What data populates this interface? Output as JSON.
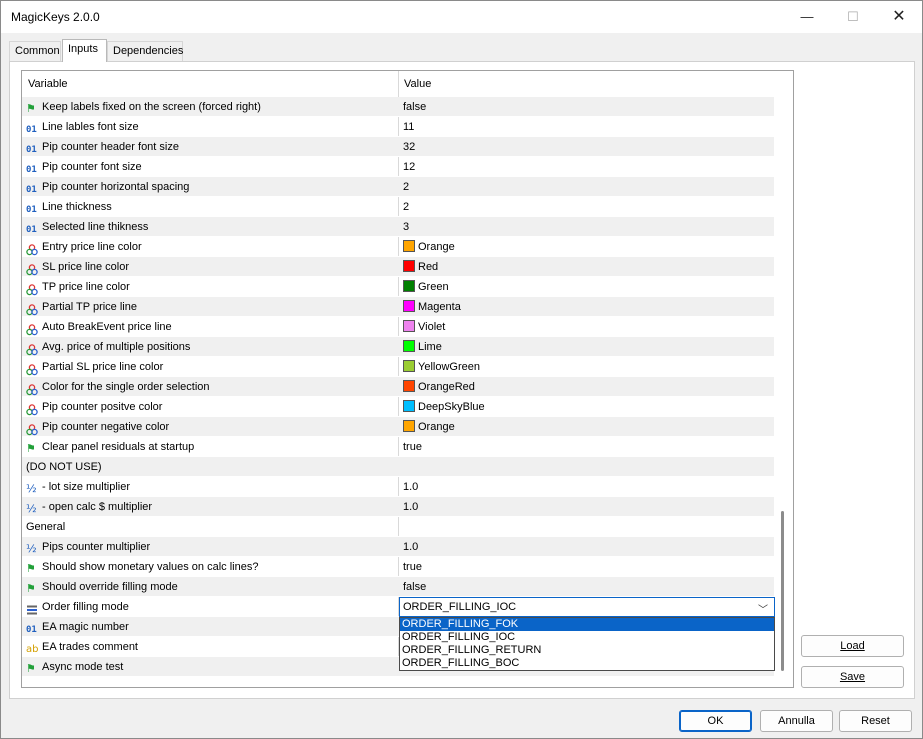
{
  "window": {
    "title": "MagicKeys 2.0.0",
    "minimize_glyph": "—",
    "maximize_glyph": "☐",
    "close_glyph": "✕"
  },
  "tabs": [
    {
      "label": "Common",
      "active": false
    },
    {
      "label": "Inputs",
      "active": true
    },
    {
      "label": "Dependencies",
      "active": false
    }
  ],
  "grid": {
    "col_variable": "Variable",
    "col_value": "Value",
    "rows": [
      {
        "icon": "bool-flag-icon",
        "name": "Keep labels fixed on the screen (forced right)",
        "value": "false"
      },
      {
        "icon": "int-icon",
        "name": "Line lables font size",
        "value": "11"
      },
      {
        "icon": "int-icon",
        "name": "Pip counter header font size",
        "value": "32"
      },
      {
        "icon": "int-icon",
        "name": "Pip counter font size",
        "value": "12"
      },
      {
        "icon": "int-icon",
        "name": "Pip counter horizontal spacing",
        "value": "2"
      },
      {
        "icon": "int-icon",
        "name": "Line thickness",
        "value": "2"
      },
      {
        "icon": "int-icon",
        "name": "Selected line thikness",
        "value": "3"
      },
      {
        "icon": "color-icon",
        "name": "Entry price line color",
        "value": "Orange",
        "swatch": "#ffa500"
      },
      {
        "icon": "color-icon",
        "name": "SL price line color",
        "value": "Red",
        "swatch": "#ff0000"
      },
      {
        "icon": "color-icon",
        "name": "TP price line color",
        "value": "Green",
        "swatch": "#008000"
      },
      {
        "icon": "color-icon",
        "name": "Partial TP price line",
        "value": "Magenta",
        "swatch": "#ff00ff"
      },
      {
        "icon": "color-icon",
        "name": "Auto BreakEvent price line",
        "value": "Violet",
        "swatch": "#ee82ee"
      },
      {
        "icon": "color-icon",
        "name": "Avg. price of multiple positions",
        "value": "Lime",
        "swatch": "#00ff00"
      },
      {
        "icon": "color-icon",
        "name": "Partial SL price line color",
        "value": "YellowGreen",
        "swatch": "#9acd32"
      },
      {
        "icon": "color-icon",
        "name": "Color for the single order selection",
        "value": "OrangeRed",
        "swatch": "#ff4500"
      },
      {
        "icon": "color-icon",
        "name": "Pip counter positve color",
        "value": "DeepSkyBlue",
        "swatch": "#00bfff"
      },
      {
        "icon": "color-icon",
        "name": "Pip counter negative color",
        "value": "Orange",
        "swatch": "#ffa500"
      },
      {
        "icon": "bool-flag-icon",
        "name": "Clear panel residuals at startup",
        "value": "true"
      },
      {
        "icon": "",
        "name": "(DO NOT USE)",
        "value": ""
      },
      {
        "icon": "double-icon",
        "name": "- lot size multiplier",
        "value": "1.0"
      },
      {
        "icon": "double-icon",
        "name": "- open calc $ multiplier",
        "value": "1.0"
      },
      {
        "icon": "",
        "name": "General",
        "value": ""
      },
      {
        "icon": "double-icon",
        "name": "Pips counter multiplier",
        "value": "1.0"
      },
      {
        "icon": "bool-flag-icon",
        "name": "Should show monetary values on calc lines?",
        "value": "true"
      },
      {
        "icon": "bool-flag-icon",
        "name": "Should override filling mode",
        "value": "false"
      },
      {
        "icon": "enum-list-icon",
        "name": "Order filling mode",
        "value": ""
      },
      {
        "icon": "int-icon",
        "name": "EA magic number",
        "value": ""
      },
      {
        "icon": "string-icon",
        "name": "EA trades comment",
        "value": ""
      },
      {
        "icon": "bool-flag-icon",
        "name": "Async mode test",
        "value": ""
      }
    ]
  },
  "dropdown": {
    "selected": "ORDER_FILLING_IOC",
    "chevron": "﹀",
    "options": [
      "ORDER_FILLING_FOK",
      "ORDER_FILLING_IOC",
      "ORDER_FILLING_RETURN",
      "ORDER_FILLING_BOC"
    ],
    "highlighted_index": 0
  },
  "icon_glyphs": {
    "int": "01",
    "double": "½",
    "string": "ab",
    "flag": "⚑"
  },
  "side_buttons": {
    "load": "Load",
    "save": "Save"
  },
  "footer_buttons": {
    "ok": "OK",
    "cancel": "Annulla",
    "reset": "Reset"
  }
}
